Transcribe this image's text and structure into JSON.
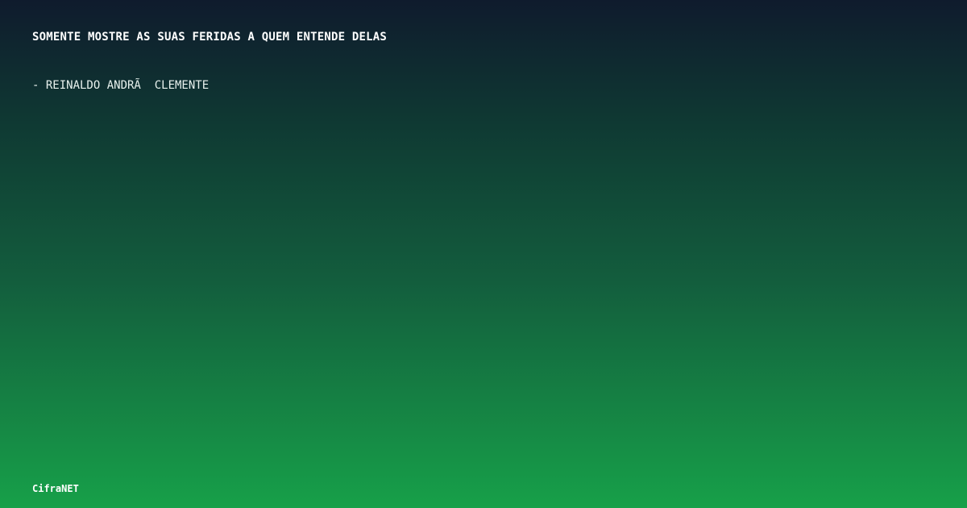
{
  "quote": {
    "text": "SOMENTE MOSTRE AS SUAS FERIDAS A QUEM ENTENDE DELAS",
    "author": "- REINALDO ANDRÃ  CLEMENTE"
  },
  "brand": {
    "name": "CifraNET"
  },
  "colors": {
    "gradient_top": "#0f1b2d",
    "gradient_bottom": "#17a049",
    "text": "#ffffff"
  }
}
